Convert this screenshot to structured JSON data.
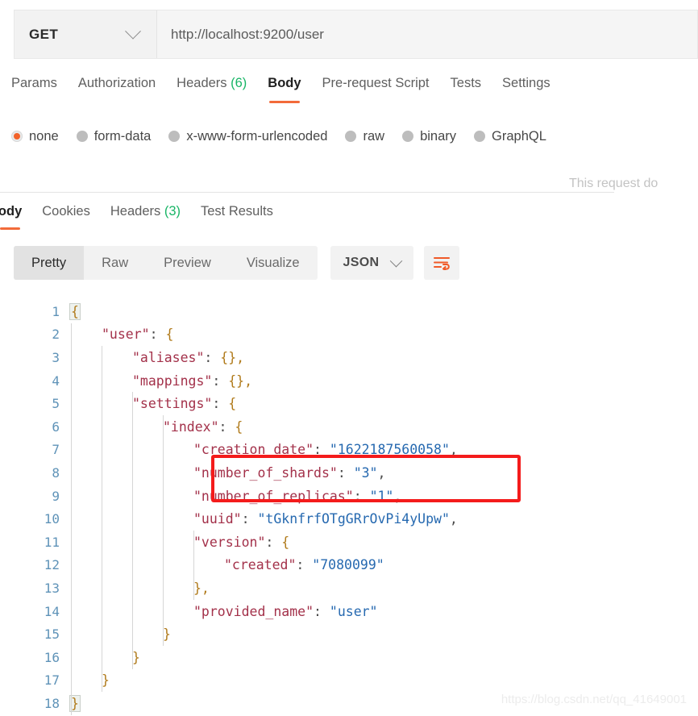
{
  "request_bar": {
    "method": "GET",
    "method_dropdown_icon": "chevron-down-icon",
    "url": "http://localhost:9200/user"
  },
  "request_tabs": {
    "items": [
      {
        "label": "Params",
        "active": false,
        "count": null
      },
      {
        "label": "Authorization",
        "active": false,
        "count": null
      },
      {
        "label": "Headers",
        "active": false,
        "count": "(6)"
      },
      {
        "label": "Body",
        "active": true,
        "count": null
      },
      {
        "label": "Pre-request Script",
        "active": false,
        "count": null
      },
      {
        "label": "Tests",
        "active": false,
        "count": null
      },
      {
        "label": "Settings",
        "active": false,
        "count": null
      }
    ]
  },
  "body_types": {
    "options": [
      {
        "label": "none",
        "selected": true
      },
      {
        "label": "form-data",
        "selected": false
      },
      {
        "label": "x-www-form-urlencoded",
        "selected": false
      },
      {
        "label": "raw",
        "selected": false
      },
      {
        "label": "binary",
        "selected": false
      },
      {
        "label": "GraphQL",
        "selected": false
      }
    ]
  },
  "request_note": "This request do",
  "response_tabs": {
    "items": [
      {
        "label": "Body",
        "active": true,
        "count": null
      },
      {
        "label": "Cookies",
        "active": false,
        "count": null
      },
      {
        "label": "Headers",
        "active": false,
        "count": "(3)"
      },
      {
        "label": "Test Results",
        "active": false,
        "count": null
      }
    ]
  },
  "view_toolbar": {
    "segments": [
      {
        "label": "Pretty",
        "active": true
      },
      {
        "label": "Raw",
        "active": false
      },
      {
        "label": "Preview",
        "active": false
      },
      {
        "label": "Visualize",
        "active": false
      }
    ],
    "format": "JSON",
    "format_dropdown_icon": "chevron-down-icon",
    "wrap_lines_icon": "wrap-lines-icon"
  },
  "response_body": {
    "lines": [
      {
        "num": "1",
        "indent": 0,
        "segments": [
          {
            "t": "{",
            "c": "br",
            "hl": true
          }
        ]
      },
      {
        "num": "2",
        "indent": 1,
        "segments": [
          {
            "t": "\"user\"",
            "c": "k"
          },
          {
            "t": ": ",
            "c": "p"
          },
          {
            "t": "{",
            "c": "br"
          }
        ]
      },
      {
        "num": "3",
        "indent": 2,
        "segments": [
          {
            "t": "\"aliases\"",
            "c": "k"
          },
          {
            "t": ": ",
            "c": "p"
          },
          {
            "t": "{},",
            "c": "br"
          }
        ]
      },
      {
        "num": "4",
        "indent": 2,
        "segments": [
          {
            "t": "\"mappings\"",
            "c": "k"
          },
          {
            "t": ": ",
            "c": "p"
          },
          {
            "t": "{},",
            "c": "br"
          }
        ]
      },
      {
        "num": "5",
        "indent": 2,
        "segments": [
          {
            "t": "\"settings\"",
            "c": "k"
          },
          {
            "t": ": ",
            "c": "p"
          },
          {
            "t": "{",
            "c": "br"
          }
        ]
      },
      {
        "num": "6",
        "indent": 3,
        "segments": [
          {
            "t": "\"index\"",
            "c": "k"
          },
          {
            "t": ": ",
            "c": "p"
          },
          {
            "t": "{",
            "c": "br"
          }
        ]
      },
      {
        "num": "7",
        "indent": 4,
        "segments": [
          {
            "t": "\"creation_date\"",
            "c": "k"
          },
          {
            "t": ": ",
            "c": "p"
          },
          {
            "t": "\"1622187560058\"",
            "c": "v"
          },
          {
            "t": ",",
            "c": "p"
          }
        ]
      },
      {
        "num": "8",
        "indent": 4,
        "segments": [
          {
            "t": "\"number_of_shards\"",
            "c": "k"
          },
          {
            "t": ": ",
            "c": "p"
          },
          {
            "t": "\"3\"",
            "c": "v"
          },
          {
            "t": ",",
            "c": "p"
          }
        ]
      },
      {
        "num": "9",
        "indent": 4,
        "segments": [
          {
            "t": "\"number_of_replicas\"",
            "c": "k"
          },
          {
            "t": ": ",
            "c": "p"
          },
          {
            "t": "\"1\"",
            "c": "v"
          },
          {
            "t": ",",
            "c": "p"
          }
        ]
      },
      {
        "num": "10",
        "indent": 4,
        "segments": [
          {
            "t": "\"uuid\"",
            "c": "k"
          },
          {
            "t": ": ",
            "c": "p"
          },
          {
            "t": "\"tGknfrfOTgGRrOvPi4yUpw\"",
            "c": "v"
          },
          {
            "t": ",",
            "c": "p"
          }
        ]
      },
      {
        "num": "11",
        "indent": 4,
        "segments": [
          {
            "t": "\"version\"",
            "c": "k"
          },
          {
            "t": ": ",
            "c": "p"
          },
          {
            "t": "{",
            "c": "br"
          }
        ]
      },
      {
        "num": "12",
        "indent": 5,
        "segments": [
          {
            "t": "\"created\"",
            "c": "k"
          },
          {
            "t": ": ",
            "c": "p"
          },
          {
            "t": "\"7080099\"",
            "c": "v"
          }
        ]
      },
      {
        "num": "13",
        "indent": 4,
        "segments": [
          {
            "t": "},",
            "c": "br"
          }
        ]
      },
      {
        "num": "14",
        "indent": 4,
        "segments": [
          {
            "t": "\"provided_name\"",
            "c": "k"
          },
          {
            "t": ": ",
            "c": "p"
          },
          {
            "t": "\"user\"",
            "c": "v"
          }
        ]
      },
      {
        "num": "15",
        "indent": 3,
        "segments": [
          {
            "t": "}",
            "c": "br"
          }
        ]
      },
      {
        "num": "16",
        "indent": 2,
        "segments": [
          {
            "t": "}",
            "c": "br"
          }
        ]
      },
      {
        "num": "17",
        "indent": 1,
        "segments": [
          {
            "t": "}",
            "c": "br"
          }
        ]
      },
      {
        "num": "18",
        "indent": 0,
        "segments": [
          {
            "t": "}",
            "c": "br",
            "hl": true
          }
        ]
      }
    ]
  },
  "annotation": {
    "highlight_color": "#f41b1b",
    "highlighted_lines": [
      "8",
      "9"
    ]
  },
  "watermark": "https://blog.csdn.net/qq_41649001"
}
